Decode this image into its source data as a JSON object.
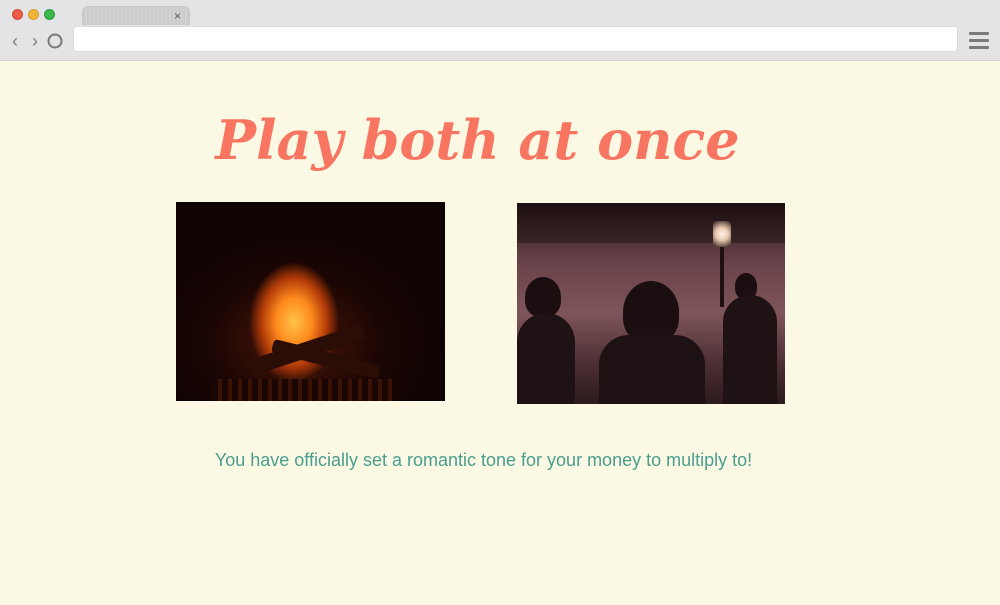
{
  "browser": {
    "tab_close": "×",
    "back_glyph": "‹",
    "forward_glyph": "›",
    "url": "",
    "icons": [
      "close-dot",
      "minimize-dot",
      "maximize-dot",
      "back-icon",
      "forward-icon",
      "reload-icon",
      "menu-icon"
    ],
    "dot_colors": [
      "#ee5c47",
      "#f0b53a",
      "#3bb84a"
    ]
  },
  "page": {
    "headline": "Play both at once",
    "caption": "You have officially set a romantic tone for your money to multiply to!",
    "colors": {
      "background": "#fbf8e4",
      "headline": "#f87661",
      "caption": "#4a9e90"
    }
  },
  "media": [
    {
      "subject": "fireplace"
    },
    {
      "subject": "dim lounge with silhouettes"
    }
  ]
}
